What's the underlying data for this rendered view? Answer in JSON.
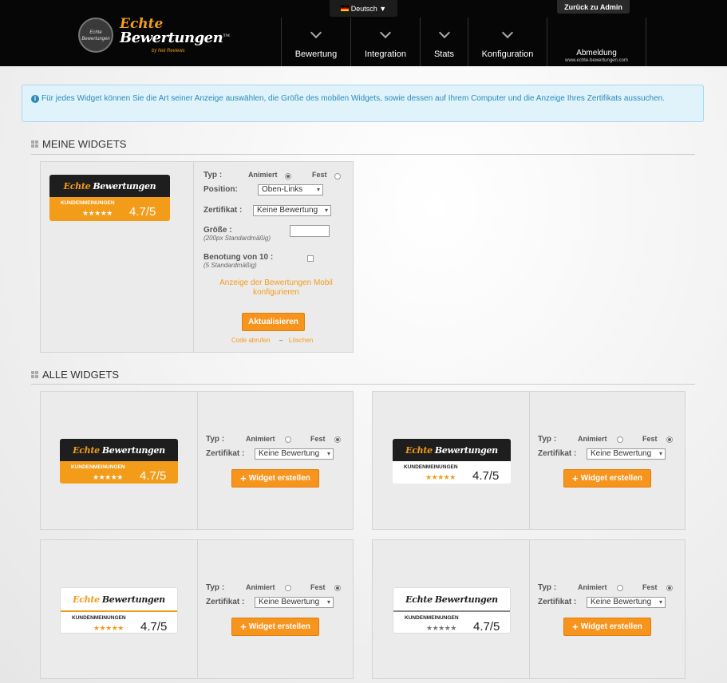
{
  "header": {
    "language": "Deutsch ▼",
    "back_admin": "Zurück zu Admin",
    "logo_seal": "Echte Bewertungen",
    "logo_echte": "Echte",
    "logo_bewertungen": "Bewertungen",
    "logo_tm": "TM",
    "logo_by": "by Net Reviews",
    "nav": [
      {
        "label": "Bewertung"
      },
      {
        "label": "Integration"
      },
      {
        "label": "Stats"
      },
      {
        "label": "Konfiguration"
      },
      {
        "label": "Abmeldung",
        "sub": "www.echte-bewertungen.com"
      }
    ]
  },
  "info": {
    "icon": "info-icon",
    "text": "Für jedes Widget können Sie die Art seiner Anzeige auswählen, die Größe des mobilen Widgets, sowie dessen auf Ihrem Computer und die Anzeige Ihres Zertifikats aussuchen."
  },
  "my_widgets": {
    "title": "MEINE WIDGETS",
    "typ_label": "Typ :",
    "animiert": "Animiert",
    "fest": "Fest",
    "selected_type": "Animiert",
    "position_label": "Position:",
    "position_value": "Oben-Links",
    "zert_label": "Zertifikat :",
    "zert_value": "Keine Bewertung",
    "size_label": "Größe :",
    "size_hint": "(200px Standardmäßig)",
    "size_value": "",
    "rating_label": "Benotung von 10 :",
    "rating_hint": "(5 Standardmäßig)",
    "rating_checked": false,
    "mobile_link": "Anzeige der Bewertungen Mobil konfigurieren",
    "update_button": "Aktualisieren",
    "code_link": "Code abrufen",
    "sep": "–",
    "delete_link": "Löschen"
  },
  "badge": {
    "echte": "Echte",
    "bewertungen": "Bewertungen",
    "kunden": "KUNDENMEINUNGEN",
    "stars": "★★★★★",
    "rating": "4.7/5"
  },
  "all_widgets": {
    "title": "ALLE WIDGETS",
    "typ_label": "Typ :",
    "animiert": "Animiert",
    "fest": "Fest",
    "zert_label": "Zertifikat :",
    "zert_value": "Keine Bewertung",
    "create_button": "Widget erstellen",
    "items": [
      {
        "style": "dark-orange",
        "selected_type": "Fest"
      },
      {
        "style": "dark-white",
        "selected_type": "Fest"
      },
      {
        "style": "light-orange",
        "selected_type": "Fest"
      },
      {
        "style": "light-gray",
        "selected_type": "Fest"
      }
    ]
  },
  "colors": {
    "accent": "#f39c1a",
    "button": "#f7941d",
    "info_bg": "#e0f3fa",
    "info_text": "#2c8ab9",
    "header_bg": "#060606"
  }
}
